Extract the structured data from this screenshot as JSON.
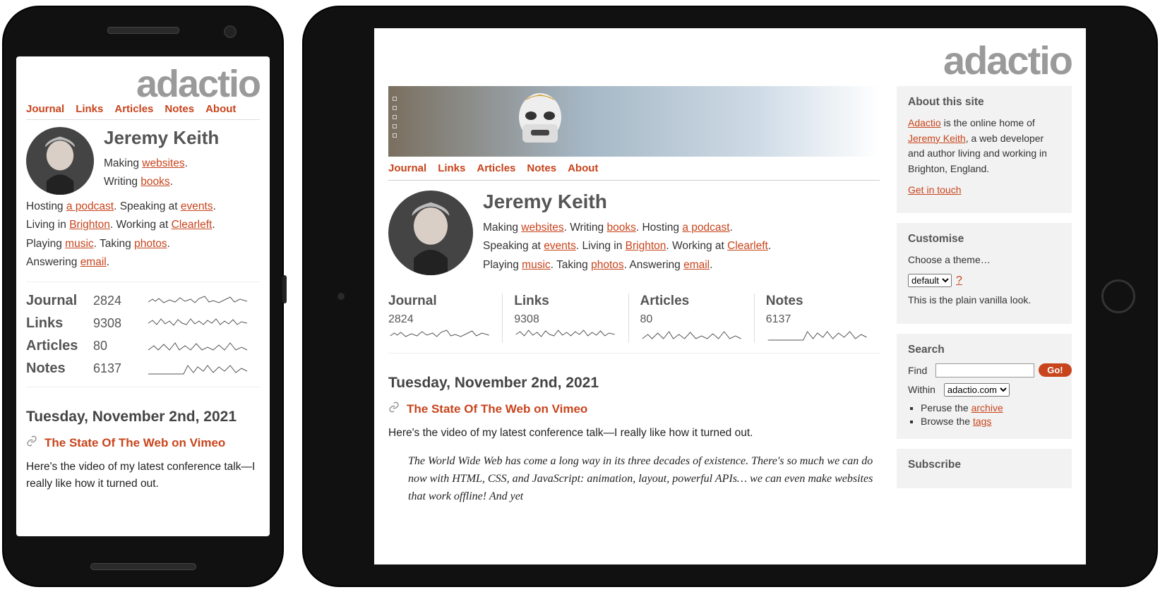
{
  "logo": "adactio",
  "nav": [
    "Journal",
    "Links",
    "Articles",
    "Notes",
    "About"
  ],
  "author": {
    "name": "Jeremy Keith",
    "bio_phrases": {
      "making": "Making ",
      "websites": "websites",
      "period": ".",
      "writing": " Writing ",
      "books": "books",
      "hosting": " Hosting ",
      "a_podcast": "a podcast",
      "speaking": " Speaking at ",
      "events": "events",
      "living": " Living in ",
      "brighton": "Brighton",
      "working": " Working at ",
      "clearleft": "Clearleft",
      "playing": " Playing ",
      "music": "music",
      "taking": " Taking ",
      "photos": "photos",
      "answering": " Answering ",
      "email": "email"
    }
  },
  "stats": {
    "journal": {
      "label": "Journal",
      "count": "2824"
    },
    "links": {
      "label": "Links",
      "count": "9308"
    },
    "articles": {
      "label": "Articles",
      "count": "80"
    },
    "notes": {
      "label": "Notes",
      "count": "6137"
    }
  },
  "post": {
    "date": "Tuesday, November 2nd, 2021",
    "title": "The State Of The Web on Vimeo",
    "excerpt_phone": "Here's the video of my latest conference talk—I really like how it turned out.",
    "excerpt_tablet": "Here's the video of my latest conference talk—I really like how it turned out.",
    "blockquote": "The World Wide Web has come a long way in its three decades of existence. There's so much we can do now with HTML, CSS, and JavaScript: animation, layout, powerful APIs… we can even make websites that work offline! And yet"
  },
  "sidebar": {
    "about": {
      "heading": "About this site",
      "link_adactio": "Adactio",
      "text_mid": " is the online home of ",
      "link_jeremy": "Jeremy Keith",
      "text_tail": ", a web developer and author living and working in Brighton, England.",
      "get_in_touch": "Get in touch"
    },
    "customise": {
      "heading": "Customise",
      "choose": "Choose a theme…",
      "selected": "default",
      "help": "?",
      "desc": "This is the plain vanilla look."
    },
    "search": {
      "heading": "Search",
      "find": "Find",
      "go": "Go!",
      "within": "Within",
      "scope_selected": "adactio.com",
      "peruse_pre": "Peruse the ",
      "peruse_link": "archive",
      "browse_pre": "Browse the ",
      "browse_link": "tags"
    },
    "subscribe": {
      "heading": "Subscribe"
    }
  }
}
